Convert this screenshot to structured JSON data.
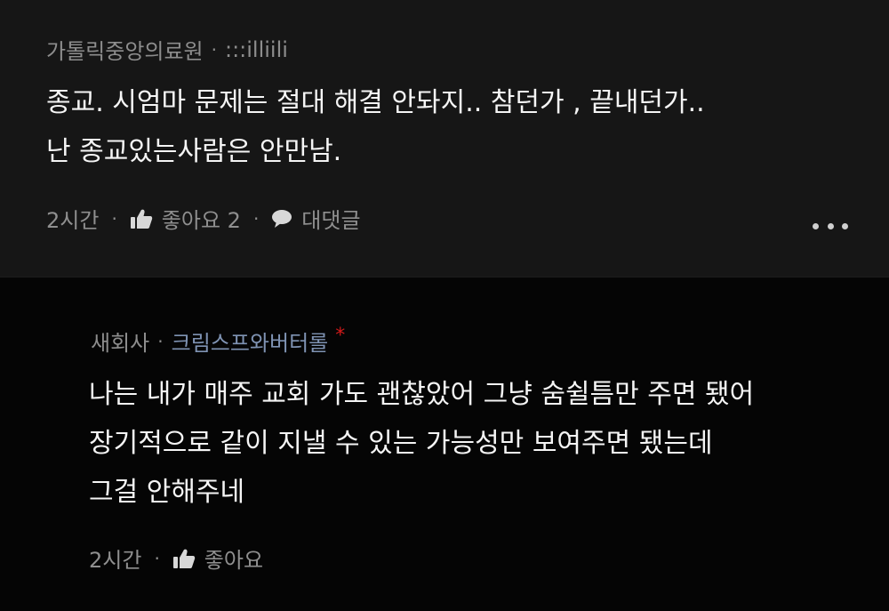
{
  "comment": {
    "hospital": "가톨릭중앙의료원",
    "nickname": ":::illiili",
    "lines": [
      "종교. 시엄마 문제는 절대 해결 안돠지.. 참던가 , 끝내던가..",
      "난 종교있는사람은 안만남."
    ],
    "time": "2시간",
    "like_label": "좋아요 2",
    "reply_label": "대댓글",
    "more_icon": "more-icon"
  },
  "reply": {
    "company": "새회사",
    "nickname": "크림스프와버터롤",
    "author_mark": "*",
    "lines": [
      "나는 내가 매주 교회 가도 괜찮았어 그냥 숨쉴틈만 주면 됐어",
      "장기적으로 같이 지낼 수 있는 가능성만 보여주면 됐는데",
      "그걸 안해주네"
    ],
    "time": "2시간",
    "like_label": "좋아요"
  },
  "separator_dot": "·",
  "colors": {
    "top_bg": "#161616",
    "reply_bg": "#050505",
    "meta_text": "#8d8d8d",
    "nickname_blue": "#7f93b3",
    "author_star": "#d11a1a"
  }
}
